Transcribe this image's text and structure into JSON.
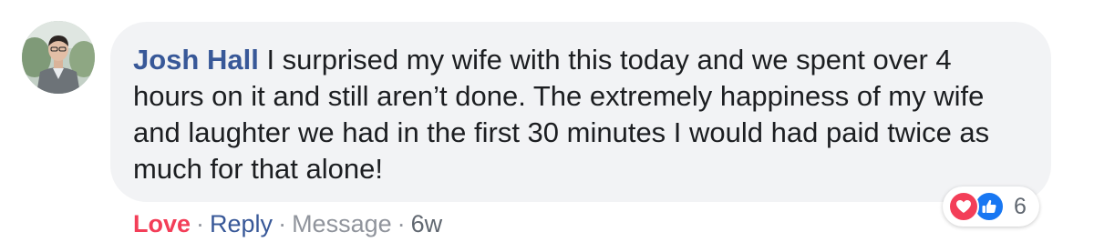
{
  "comment": {
    "author": "Josh Hall",
    "text": " I surprised my wife with this today and we spent over 4 hours on it and still aren’t done. The extremely happiness of my wife and laughter we had in the first 30 minutes I would had paid twice as much for that alone!"
  },
  "actions": {
    "love_label": "Love",
    "separator": "·",
    "reply_label": "Reply",
    "message_label": "Message",
    "timestamp": "6w"
  },
  "reactions": {
    "icons": [
      "love-icon",
      "like-icon"
    ],
    "count": "6"
  },
  "colors": {
    "author_blue": "#385898",
    "love_red": "#f33e58",
    "like_blue": "#1877f2",
    "bubble_bg": "#f2f3f5",
    "meta_gray": "#606770"
  }
}
